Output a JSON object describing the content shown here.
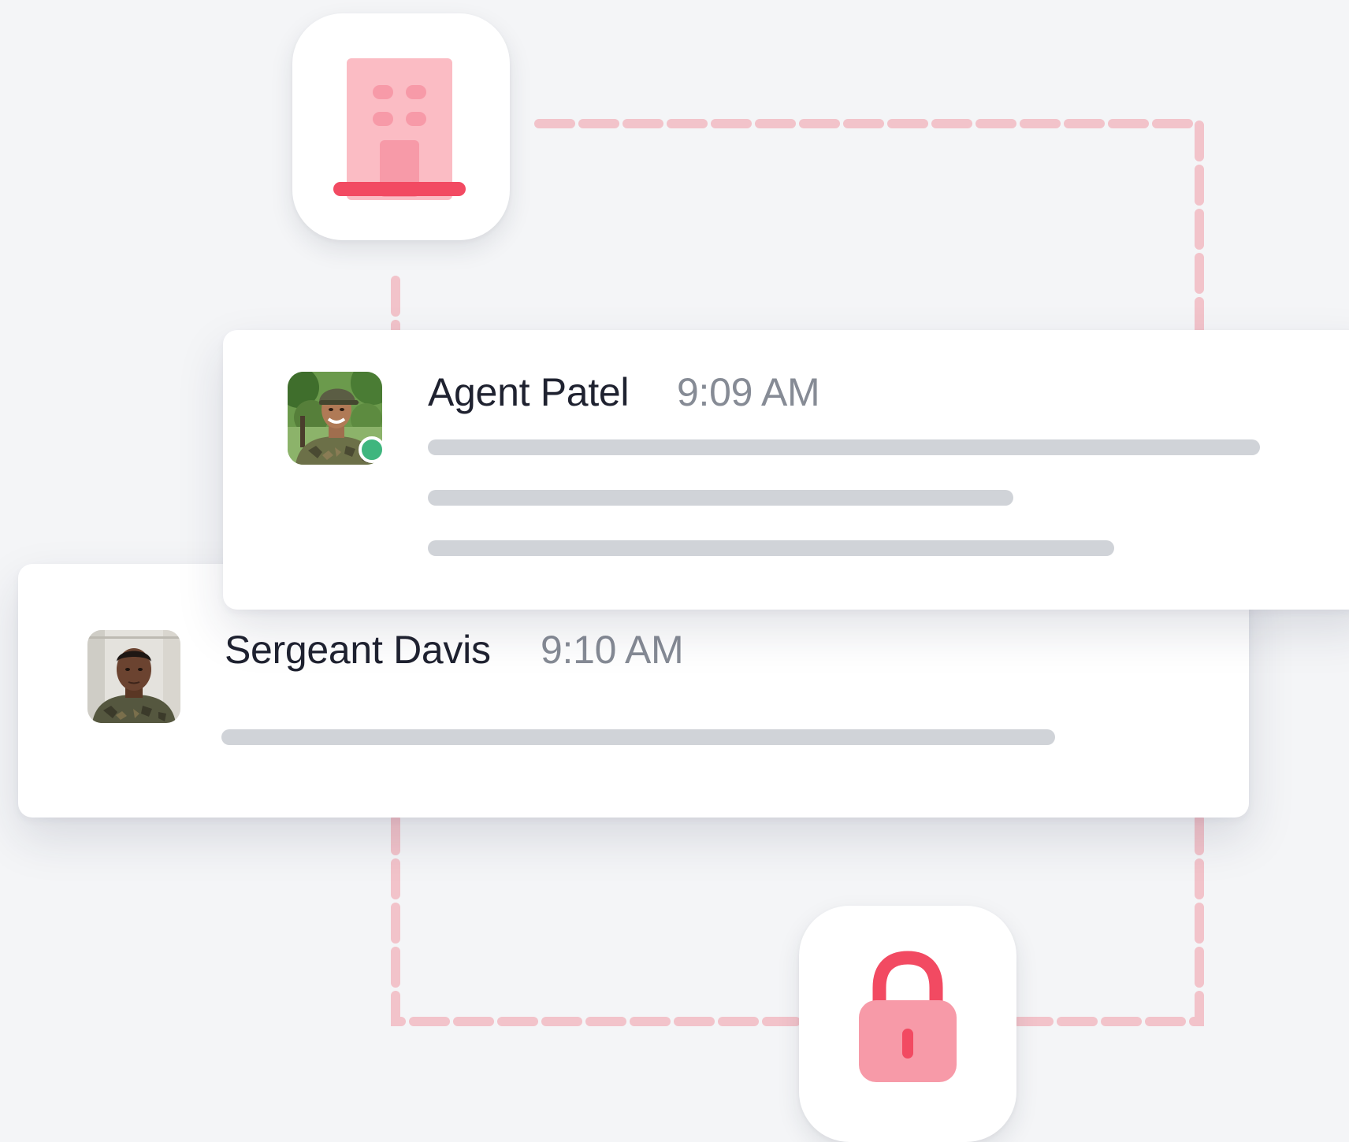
{
  "colors": {
    "background": "#f4f5f7",
    "connector": "#f2c3ca",
    "accent": "#f24a62",
    "icon_light": "#fbbcc4",
    "presence_online": "#3fb67e",
    "placeholder_line": "#d0d3d8"
  },
  "icons": {
    "building": "building-icon",
    "lock": "lock-icon"
  },
  "messages": [
    {
      "author": "Agent Patel",
      "time": "9:09 AM",
      "avatar": "avatar-soldier-smiling",
      "online": true,
      "placeholder_lines": 3
    },
    {
      "author": "Sergeant Davis",
      "time": "9:10 AM",
      "avatar": "avatar-soldier-portrait",
      "online": false,
      "placeholder_lines": 1
    }
  ]
}
